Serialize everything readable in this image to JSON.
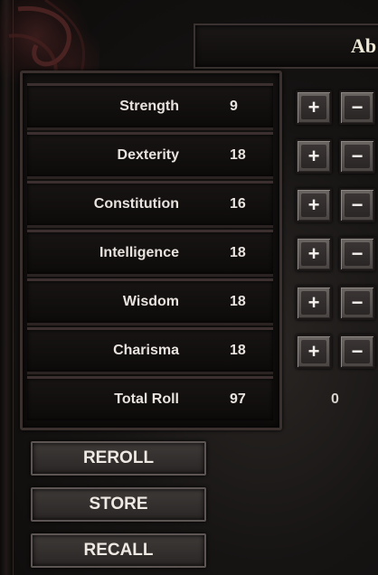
{
  "title": "Ab",
  "stats": [
    {
      "label": "Strength",
      "value": "9"
    },
    {
      "label": "Dexterity",
      "value": "18"
    },
    {
      "label": "Constitution",
      "value": "16"
    },
    {
      "label": "Intelligence",
      "value": "18"
    },
    {
      "label": "Wisdom",
      "value": "18"
    },
    {
      "label": "Charisma",
      "value": "18"
    }
  ],
  "total": {
    "label": "Total Roll",
    "value": "97",
    "points": "0"
  },
  "buttons": {
    "plus": "+",
    "minus": "−",
    "reroll": "REROLL",
    "store": "STORE",
    "recall": "RECALL"
  }
}
